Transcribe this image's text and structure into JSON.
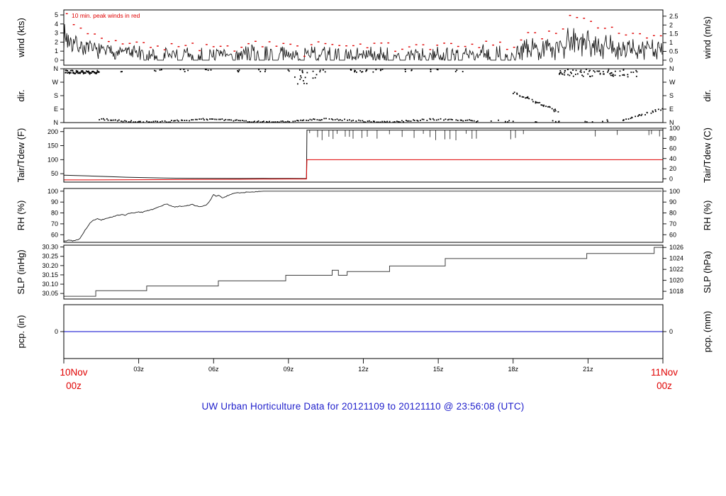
{
  "chart_data": {
    "type": "line",
    "title": "UW Urban Horticulture Data for 20121109  to  20121110 @ 23:56:08  (UTC)",
    "title_color": "#2121cc",
    "seed": 7,
    "x_axis": {
      "range_hours": [
        0,
        24
      ],
      "tick_hours": [
        0,
        3,
        6,
        9,
        12,
        15,
        18,
        21,
        24
      ],
      "tick_labels": [
        "",
        "03z",
        "06z",
        "09z",
        "12z",
        "15z",
        "18z",
        "21z",
        ""
      ],
      "start_label": {
        "line1": "10Nov",
        "line2": "00z",
        "color": "#e00000"
      },
      "end_label": {
        "line1": "11Nov",
        "line2": "00z",
        "color": "#e00000"
      }
    },
    "colors": {
      "frame": "#000000",
      "black_line": "#1a1a1a",
      "red": "#e00000",
      "slp_line": "#404040",
      "pcp_line": "#0000cc"
    },
    "panels": [
      {
        "id": "wind",
        "left_label": "wind (kts)",
        "right_label": "wind (m/s)",
        "ylim": [
          -0.55,
          5.55
        ],
        "left_ticks": [
          {
            "v": 0,
            "label": "0"
          },
          {
            "v": 1,
            "label": "1"
          },
          {
            "v": 2,
            "label": "2"
          },
          {
            "v": 3,
            "label": "3"
          },
          {
            "v": 4,
            "label": "4"
          },
          {
            "v": 5,
            "label": "5"
          }
        ],
        "right_unit": {
          "mul": 1.94384,
          "add": 0
        },
        "right_ticks": [
          {
            "v": 0,
            "label": "0"
          },
          {
            "v": 0.5,
            "label": "0.5"
          },
          {
            "v": 1,
            "label": "1"
          },
          {
            "v": 1.5,
            "label": "1.5"
          },
          {
            "v": 2,
            "label": "2"
          },
          {
            "v": 2.5,
            "label": "2.5"
          }
        ],
        "annotation": {
          "text": "10 min. peak winds in red",
          "color": "#e00000"
        },
        "mean_envelope": [
          [
            0,
            2.8,
            1.0
          ],
          [
            0.3,
            2.0,
            0.8
          ],
          [
            0.8,
            1.4,
            0.6
          ],
          [
            1.5,
            1.05,
            0.5
          ],
          [
            2.5,
            0.85,
            0.55
          ],
          [
            3.5,
            0.55,
            0.55
          ],
          [
            4.5,
            0.65,
            0.6
          ],
          [
            5.5,
            0.5,
            0.55
          ],
          [
            6.5,
            0.6,
            0.6
          ],
          [
            7.5,
            0.65,
            0.6
          ],
          [
            8.5,
            0.55,
            0.6
          ],
          [
            9.5,
            0.65,
            0.65
          ],
          [
            10.5,
            0.6,
            0.6
          ],
          [
            11.5,
            0.65,
            0.65
          ],
          [
            12.5,
            0.6,
            0.6
          ],
          [
            13.5,
            0.65,
            0.65
          ],
          [
            14.5,
            0.6,
            0.65
          ],
          [
            15.5,
            0.7,
            0.65
          ],
          [
            16.5,
            0.65,
            0.65
          ],
          [
            17.5,
            0.75,
            0.7
          ],
          [
            18.5,
            1.0,
            0.8
          ],
          [
            19.3,
            1.3,
            0.9
          ],
          [
            20.0,
            1.9,
            1.1
          ],
          [
            20.6,
            2.3,
            1.2
          ],
          [
            21.2,
            2.1,
            1.2
          ],
          [
            21.8,
            1.4,
            0.9
          ],
          [
            22.5,
            1.1,
            0.8
          ],
          [
            23.2,
            1.2,
            0.8
          ],
          [
            24,
            1.0,
            0.7
          ]
        ],
        "red_peak_offset": [
          [
            0,
            1.6
          ],
          [
            0.7,
            1.1
          ],
          [
            1.5,
            0.8
          ],
          [
            3,
            0.55
          ],
          [
            17,
            0.55
          ],
          [
            19,
            0.9
          ],
          [
            20,
            1.9
          ],
          [
            20.8,
            2.3
          ],
          [
            21.4,
            1.6
          ],
          [
            22,
            1.0
          ],
          [
            23,
            0.8
          ],
          [
            24,
            0.7
          ]
        ],
        "sample_step_hours": 0.03,
        "red_dot_step_hours": 0.28
      },
      {
        "id": "dir",
        "left_label": "dir.",
        "right_label": "dir.",
        "ylim": [
          0,
          360
        ],
        "left_ticks": [
          {
            "v": 360,
            "label": "N"
          },
          {
            "v": 270,
            "label": "W"
          },
          {
            "v": 180,
            "label": "S"
          },
          {
            "v": 90,
            "label": "E"
          },
          {
            "v": 0,
            "label": "N"
          }
        ],
        "right_unit": {
          "mul": 1,
          "add": 0
        },
        "right_ticks": [
          {
            "v": 360,
            "label": "N"
          },
          {
            "v": 270,
            "label": "W"
          },
          {
            "v": 180,
            "label": "S"
          },
          {
            "v": 90,
            "label": "E"
          },
          {
            "v": 0,
            "label": "N"
          }
        ],
        "clusters": [
          {
            "name": "nnw-early-band",
            "type": "band",
            "h": [
              0.05,
              1.42
            ],
            "deg": [
              326,
              348
            ],
            "n": 75
          },
          {
            "name": "n-bottom-band",
            "type": "wave",
            "h": [
              1.42,
              16.6
            ],
            "deg": [
              3,
              34
            ],
            "base": 13,
            "wave_amp": 9,
            "n": 210
          },
          {
            "name": "top-sparse-groups",
            "type": "groups",
            "h": [
              2.1,
              16.3
            ],
            "deg": [
              339,
              358
            ],
            "n": 40,
            "groups": 13
          },
          {
            "name": "mid-cluster-0930",
            "type": "box",
            "h": [
              9.25,
              10.15
            ],
            "deg": [
              258,
              352
            ],
            "n": 18
          },
          {
            "name": "mid-cluster-1200",
            "type": "box",
            "h": [
              11.55,
              12.6
            ],
            "deg": [
              330,
              357
            ],
            "n": 12
          },
          {
            "name": "diagonal-evening",
            "type": "diag",
            "h": [
              18.05,
              19.8
            ],
            "deg": [
              200,
              72
            ],
            "n": 34,
            "jitter": 16
          },
          {
            "name": "nw-late-dense",
            "type": "box",
            "h": [
              19.85,
              23.05
            ],
            "deg": [
              306,
              358
            ],
            "n": 70
          },
          {
            "name": "bottom-sparse-late",
            "type": "groups",
            "h": [
              16.7,
              22.2
            ],
            "deg": [
              3,
              18
            ],
            "n": 16,
            "groups": 6
          },
          {
            "name": "ne-rise-end",
            "type": "diag",
            "h": [
              22.35,
              24.0
            ],
            "deg": [
              8,
              96
            ],
            "n": 26,
            "jitter": 14
          }
        ]
      },
      {
        "id": "temp",
        "left_label": "Tair/Tdew (F)",
        "right_label": "Tair/Tdew (C)",
        "ylim": [
          20,
          212
        ],
        "left_ticks": [
          {
            "v": 50,
            "label": "50"
          },
          {
            "v": 100,
            "label": "100"
          },
          {
            "v": 150,
            "label": "150"
          },
          {
            "v": 200,
            "label": "200"
          }
        ],
        "right_unit": {
          "mul": 1.8,
          "add": 32
        },
        "right_ticks": [
          {
            "v": 0,
            "label": "0"
          },
          {
            "v": 20,
            "label": "20"
          },
          {
            "v": 40,
            "label": "40"
          },
          {
            "v": 60,
            "label": "60"
          },
          {
            "v": 80,
            "label": "80"
          },
          {
            "v": 100,
            "label": "100"
          }
        ],
        "tair": [
          [
            0,
            44.5
          ],
          [
            0.5,
            43.5
          ],
          [
            1,
            42
          ],
          [
            1.5,
            40.5
          ],
          [
            2,
            39
          ],
          [
            2.5,
            37.5
          ],
          [
            3,
            36.5
          ],
          [
            3.5,
            35.5
          ],
          [
            4,
            34.5
          ],
          [
            4.5,
            34
          ],
          [
            5,
            33.7
          ],
          [
            6,
            33.2
          ],
          [
            7,
            33
          ],
          [
            8,
            33.1
          ],
          [
            9,
            32.8
          ],
          [
            9.72,
            32.7
          ]
        ],
        "tdew": [
          [
            0,
            27.8
          ],
          [
            1,
            28
          ],
          [
            2,
            28.3
          ],
          [
            3,
            28.6
          ],
          [
            4,
            29
          ],
          [
            5,
            29.4
          ],
          [
            6,
            29.8
          ],
          [
            7,
            30.2
          ],
          [
            8,
            30.7
          ],
          [
            9,
            31
          ],
          [
            9.72,
            31.2
          ]
        ],
        "sensor_fail": {
          "start_hour": 9.72,
          "tair_level": 205.5,
          "tdew_level": 100,
          "spike_depth_range": [
            10,
            38
          ],
          "spike_gap_hours": [
            [
              12.2,
              12.45
            ],
            [
              16.6,
              17.85
            ],
            [
              18.7,
              20.9
            ],
            [
              21.5,
              21.95
            ],
            [
              22.25,
              23.1
            ],
            [
              23.6,
              23.8
            ]
          ]
        }
      },
      {
        "id": "rh",
        "left_label": "RH (%)",
        "right_label": "RH (%)",
        "ylim": [
          53,
          102.5
        ],
        "left_ticks": [
          {
            "v": 60,
            "label": "60"
          },
          {
            "v": 70,
            "label": "70"
          },
          {
            "v": 80,
            "label": "80"
          },
          {
            "v": 90,
            "label": "90"
          },
          {
            "v": 100,
            "label": "100"
          }
        ],
        "right_unit": {
          "mul": 1,
          "add": 0
        },
        "right_ticks": [
          {
            "v": 60,
            "label": "60"
          },
          {
            "v": 70,
            "label": "70"
          },
          {
            "v": 80,
            "label": "80"
          },
          {
            "v": 90,
            "label": "90"
          },
          {
            "v": 100,
            "label": "100"
          }
        ],
        "points": [
          [
            0,
            54
          ],
          [
            0.2,
            55
          ],
          [
            0.35,
            54.5
          ],
          [
            0.5,
            55
          ],
          [
            0.6,
            56
          ],
          [
            0.65,
            57
          ],
          [
            0.75,
            60
          ],
          [
            0.85,
            64
          ],
          [
            1.0,
            69
          ],
          [
            1.1,
            72
          ],
          [
            1.2,
            73.5
          ],
          [
            1.35,
            74.5
          ],
          [
            1.5,
            73.5
          ],
          [
            1.7,
            75
          ],
          [
            1.9,
            76
          ],
          [
            2.1,
            77.5
          ],
          [
            2.3,
            78.5
          ],
          [
            2.45,
            78
          ],
          [
            2.6,
            79.5
          ],
          [
            2.8,
            80
          ],
          [
            3.0,
            81
          ],
          [
            3.15,
            80.5
          ],
          [
            3.3,
            82
          ],
          [
            3.5,
            83
          ],
          [
            3.7,
            84.5
          ],
          [
            3.85,
            86
          ],
          [
            4.0,
            87.5
          ],
          [
            4.15,
            88
          ],
          [
            4.3,
            86.5
          ],
          [
            4.45,
            85.5
          ],
          [
            4.6,
            86
          ],
          [
            4.8,
            86.5
          ],
          [
            5.0,
            87
          ],
          [
            5.15,
            88
          ],
          [
            5.3,
            86.5
          ],
          [
            5.45,
            85.5
          ],
          [
            5.6,
            86.5
          ],
          [
            5.75,
            88
          ],
          [
            5.9,
            93
          ],
          [
            6.0,
            97
          ],
          [
            6.1,
            95.5
          ],
          [
            6.2,
            96.5
          ],
          [
            6.35,
            93.5
          ],
          [
            6.5,
            95
          ],
          [
            6.65,
            97
          ],
          [
            6.8,
            98
          ],
          [
            7.0,
            98.5
          ],
          [
            7.3,
            99
          ],
          [
            7.6,
            99.5
          ],
          [
            8.0,
            100
          ],
          [
            24,
            100
          ]
        ]
      },
      {
        "id": "slp",
        "left_label": "SLP (inHg)",
        "right_label": "SLP (hPa)",
        "ylim": [
          30.02,
          30.31
        ],
        "left_ticks": [
          {
            "v": 30.05,
            "label": "30.05"
          },
          {
            "v": 30.1,
            "label": "30.10"
          },
          {
            "v": 30.15,
            "label": "30.15"
          },
          {
            "v": 30.2,
            "label": "30.20"
          },
          {
            "v": 30.25,
            "label": "30.25"
          },
          {
            "v": 30.3,
            "label": "30.30"
          }
        ],
        "right_unit": {
          "mul": 0.02953,
          "add": 0
        },
        "right_ticks": [
          {
            "v": 1018,
            "label": "1018"
          },
          {
            "v": 1020,
            "label": "1020"
          },
          {
            "v": 1022,
            "label": "1022"
          },
          {
            "v": 1024,
            "label": "1024"
          },
          {
            "v": 1026,
            "label": "1026"
          }
        ],
        "steps": [
          [
            0,
            30.035
          ],
          [
            1.28,
            30.065
          ],
          [
            3.32,
            30.09
          ],
          [
            6.19,
            30.118
          ],
          [
            8.89,
            30.148
          ],
          [
            10.75,
            30.175
          ],
          [
            11.0,
            30.148
          ],
          [
            11.35,
            30.168
          ],
          [
            13.05,
            30.198
          ],
          [
            15.28,
            30.238
          ],
          [
            20.95,
            30.265
          ],
          [
            23.65,
            30.298
          ],
          [
            24,
            30.298
          ]
        ]
      },
      {
        "id": "pcp",
        "left_label": "pcp. (in)",
        "right_label": "pcp. (mm)",
        "ylim": [
          -1,
          1
        ],
        "left_ticks": [
          {
            "v": 0,
            "label": "0"
          }
        ],
        "right_unit": {
          "mul": 1,
          "add": 0
        },
        "right_ticks": [
          {
            "v": 0,
            "label": "0"
          }
        ],
        "constant_value": 0
      }
    ]
  }
}
